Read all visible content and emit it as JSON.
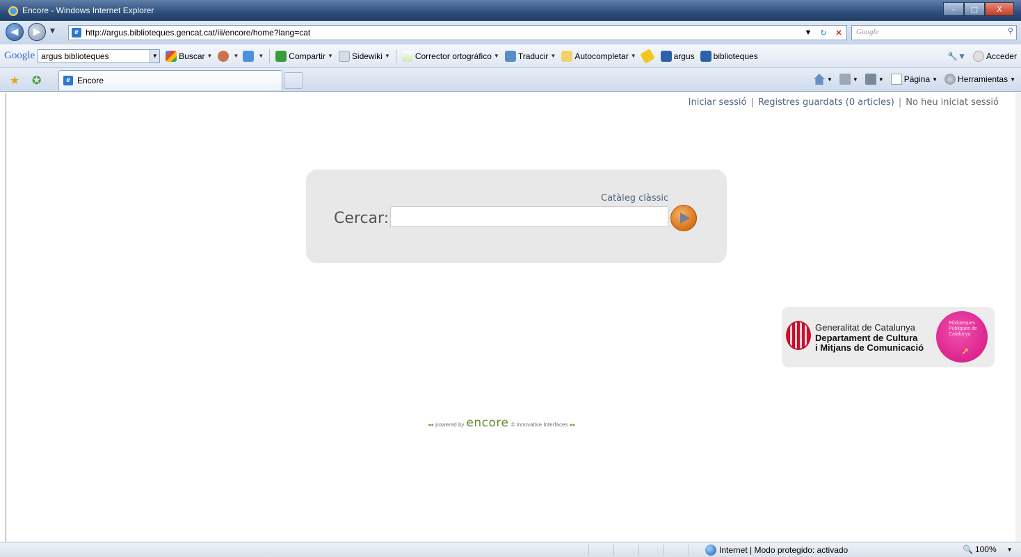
{
  "window": {
    "title": "Encore - Windows Internet Explorer",
    "controls": [
      "–",
      "□",
      "X"
    ]
  },
  "address_bar": {
    "url": "http://argus.biblioteques.gencat.cat/iii/encore/home?lang=cat",
    "search_placeholder": "Google"
  },
  "google_toolbar": {
    "logo": "Google",
    "query": "argus biblioteques",
    "items": [
      "Buscar",
      "Compartir",
      "Sidewiki",
      "Corrector ortográfico",
      "Traducir",
      "Autocompletar",
      "argus",
      "biblioteques"
    ],
    "acceder": "Acceder"
  },
  "tab": {
    "title": "Encore"
  },
  "command_bar": {
    "page": "Página",
    "tools": "Herramientas"
  },
  "page": {
    "links": {
      "login": "Iniciar sessió",
      "saved": "Registres guardats (0 articles)",
      "status": "No heu iniciat sessió"
    },
    "search": {
      "classic_link": "Catàleg clàssic",
      "label": "Cercar:",
      "value": ""
    },
    "logo": {
      "line1": "Generalitat de Catalunya",
      "line2": "Departament de Cultura",
      "line3": "i Mitjans de Comunicació",
      "badge": "Biblioteques Públiques de Catalunya"
    },
    "footer": {
      "powered_by": "powered by",
      "brand": "encore",
      "vendor": "© Innovative Interfaces"
    }
  },
  "status_bar": {
    "zone": "Internet | Modo protegido: activado",
    "zoom": "100%"
  }
}
